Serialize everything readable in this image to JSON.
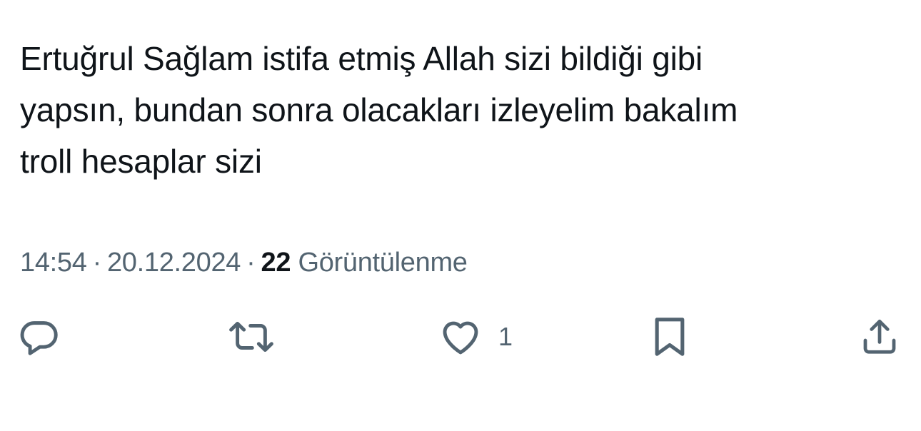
{
  "tweet": {
    "text_lines": [
      "Ertuğrul Sağlam istifa etmiş Allah sizi bildiği gibi",
      "yapsın, bundan sonra olacakları izleyelim bakalım",
      "troll hesaplar sizi"
    ],
    "time": "14:54",
    "separator": "·",
    "date": "20.12.2024",
    "views_count": "22",
    "views_label": "Görüntülenme"
  },
  "actions": {
    "reply": {
      "icon": "reply-icon"
    },
    "retweet": {
      "icon": "retweet-icon"
    },
    "like": {
      "icon": "heart-icon",
      "count": "1"
    },
    "bookmark": {
      "icon": "bookmark-icon"
    },
    "share": {
      "icon": "share-icon"
    }
  },
  "colors": {
    "text": "#0f1419",
    "secondary": "#536471",
    "background": "#ffffff"
  }
}
